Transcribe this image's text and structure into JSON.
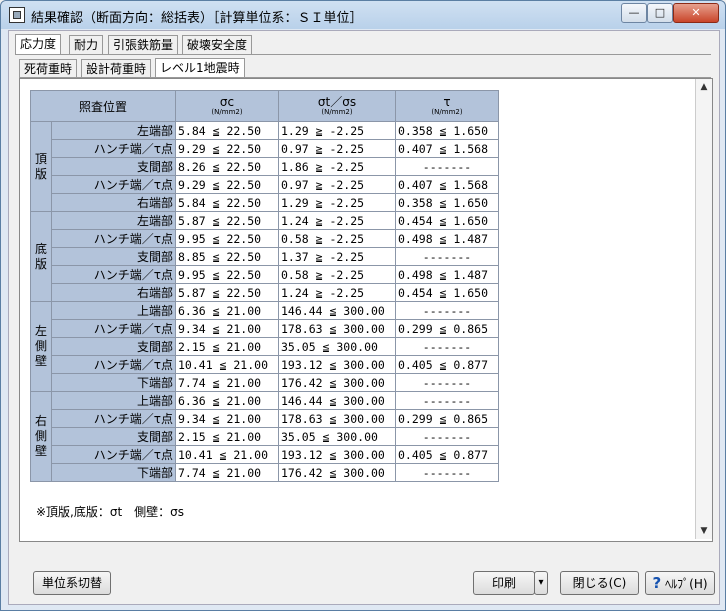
{
  "window": {
    "title": "結果確認（断面方向：総括表）［計算単位系：ＳＩ単位］"
  },
  "tabs_main": [
    "応力度",
    "耐力",
    "引張鉄筋量",
    "破壊安全度"
  ],
  "tabs_sub": [
    "死荷重時",
    "設計荷重時",
    "レベル1地震時"
  ],
  "table": {
    "headers": {
      "position": "照査位置",
      "sigma_c": "σc",
      "sigma_ts": "σt／σs",
      "tau": "τ",
      "unit": "(N/mm2)"
    },
    "groups": [
      {
        "name": "頂版",
        "rows": [
          {
            "loc": "左端部",
            "c": "5.84 ≦ 22.50",
            "s": "1.29 ≧ -2.25",
            "t": "0.358 ≦ 1.650"
          },
          {
            "loc": "ハンチ端／τ点",
            "c": "9.29 ≦ 22.50",
            "s": "0.97 ≧ -2.25",
            "t": "0.407 ≦ 1.568"
          },
          {
            "loc": "支間部",
            "c": "8.26 ≦ 22.50",
            "s": "1.86 ≧ -2.25",
            "t": "-------"
          },
          {
            "loc": "ハンチ端／τ点",
            "c": "9.29 ≦ 22.50",
            "s": "0.97 ≧ -2.25",
            "t": "0.407 ≦ 1.568"
          },
          {
            "loc": "右端部",
            "c": "5.84 ≦ 22.50",
            "s": "1.29 ≧ -2.25",
            "t": "0.358 ≦ 1.650"
          }
        ]
      },
      {
        "name": "底版",
        "rows": [
          {
            "loc": "左端部",
            "c": "5.87 ≦ 22.50",
            "s": "1.24 ≧ -2.25",
            "t": "0.454 ≦ 1.650"
          },
          {
            "loc": "ハンチ端／τ点",
            "c": "9.95 ≦ 22.50",
            "s": "0.58 ≧ -2.25",
            "t": "0.498 ≦ 1.487"
          },
          {
            "loc": "支間部",
            "c": "8.85 ≦ 22.50",
            "s": "1.37 ≧ -2.25",
            "t": "-------"
          },
          {
            "loc": "ハンチ端／τ点",
            "c": "9.95 ≦ 22.50",
            "s": "0.58 ≧ -2.25",
            "t": "0.498 ≦ 1.487"
          },
          {
            "loc": "右端部",
            "c": "5.87 ≦ 22.50",
            "s": "1.24 ≧ -2.25",
            "t": "0.454 ≦ 1.650"
          }
        ]
      },
      {
        "name": "左側壁",
        "rows": [
          {
            "loc": "上端部",
            "c": "6.36 ≦ 21.00",
            "s": "146.44 ≦ 300.00",
            "t": "-------"
          },
          {
            "loc": "ハンチ端／τ点",
            "c": "9.34 ≦ 21.00",
            "s": "178.63 ≦ 300.00",
            "t": "0.299 ≦ 0.865"
          },
          {
            "loc": "支間部",
            "c": "2.15 ≦ 21.00",
            "s": "35.05 ≦ 300.00",
            "t": "-------"
          },
          {
            "loc": "ハンチ端／τ点",
            "c": "10.41 ≦ 21.00",
            "s": "193.12 ≦ 300.00",
            "t": "0.405 ≦ 0.877"
          },
          {
            "loc": "下端部",
            "c": "7.74 ≦ 21.00",
            "s": "176.42 ≦ 300.00",
            "t": "-------"
          }
        ]
      },
      {
        "name": "右側壁",
        "rows": [
          {
            "loc": "上端部",
            "c": "6.36 ≦ 21.00",
            "s": "146.44 ≦ 300.00",
            "t": "-------"
          },
          {
            "loc": "ハンチ端／τ点",
            "c": "9.34 ≦ 21.00",
            "s": "178.63 ≦ 300.00",
            "t": "0.299 ≦ 0.865"
          },
          {
            "loc": "支間部",
            "c": "2.15 ≦ 21.00",
            "s": "35.05 ≦ 300.00",
            "t": "-------"
          },
          {
            "loc": "ハンチ端／τ点",
            "c": "10.41 ≦ 21.00",
            "s": "193.12 ≦ 300.00",
            "t": "0.405 ≦ 0.877"
          },
          {
            "loc": "下端部",
            "c": "7.74 ≦ 21.00",
            "s": "176.42 ≦ 300.00",
            "t": "-------"
          }
        ]
      }
    ]
  },
  "note": "※頂版,底版：σt　側壁：σs",
  "buttons": {
    "unit_switch": "単位系切替",
    "print": "印刷",
    "print_arrow": "▾",
    "close": "閉じる(C)",
    "help": "ﾍﾙﾌﾟ(H)",
    "help_glyph": "?"
  },
  "window_controls": {
    "minimize": "—",
    "maximize": "□",
    "close": "✕"
  },
  "scroll": {
    "up": "▲",
    "down": "▼"
  },
  "colors": {
    "header_bg": "#b3c3da",
    "title_bg": "#c4d8ee"
  }
}
